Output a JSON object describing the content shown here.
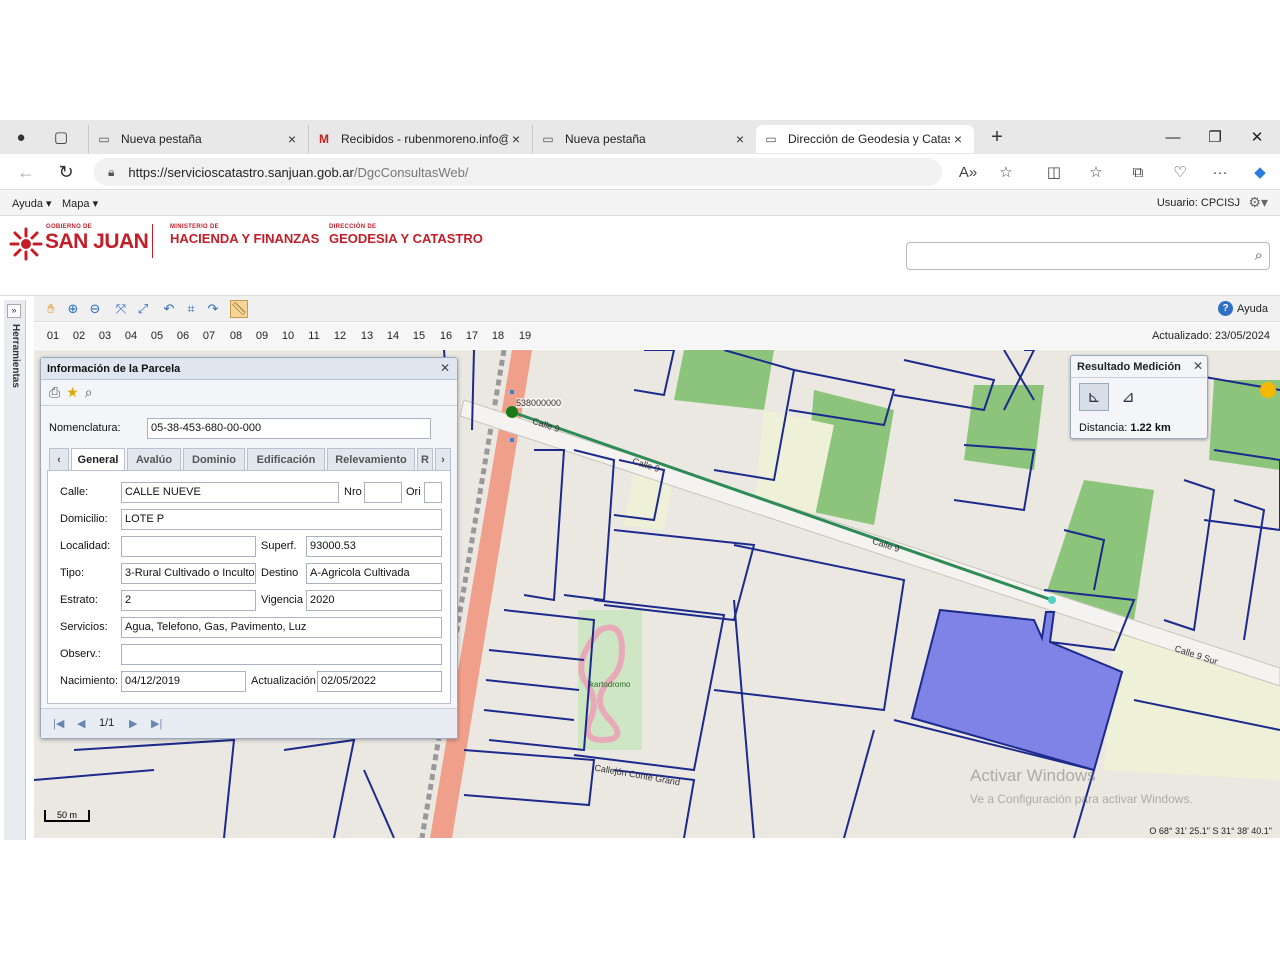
{
  "browser": {
    "tabs": [
      {
        "title": "Nueva pestaña",
        "icon": "page-icon"
      },
      {
        "title": "Recibidos - rubenmoreno.info@",
        "icon": "gmail-icon"
      },
      {
        "title": "Nueva pestaña",
        "icon": "page-icon"
      },
      {
        "title": "Dirección de Geodesia y Catastro",
        "icon": "page-icon",
        "active": true
      }
    ],
    "url_host": "https://servicioscatastro.sanjuan.gob.ar",
    "url_path": "/DgcConsultasWeb/"
  },
  "app": {
    "menu": [
      "Ayuda ▾",
      "Mapa ▾"
    ],
    "user": "Usuario: CPCISJ",
    "brand": {
      "gov_small": "GOBIERNO DE",
      "gov_big": "SAN JUAN",
      "min_small": "MINISTERIO DE",
      "min_big": "HACIENDA Y FINANZAS",
      "dir_small": "DIRECCIÓN DE",
      "dir_big": "GEODESIA Y CATASTRO"
    },
    "help_label": "Ayuda",
    "zones": [
      "01",
      "02",
      "03",
      "04",
      "05",
      "06",
      "07",
      "08",
      "09",
      "10",
      "11",
      "12",
      "13",
      "14",
      "15",
      "16",
      "17",
      "18",
      "19"
    ],
    "updated": "Actualizado: 23/05/2024",
    "side_label": "Herramientas"
  },
  "parcel": {
    "title": "Información de la Parcela",
    "nomenclatura_label": "Nomenclatura:",
    "nomenclatura": "05-38-453-680-00-000",
    "tabs": [
      "General",
      "Avalúo",
      "Dominio",
      "Edificación",
      "Relevamiento",
      "R"
    ],
    "fields": {
      "calle_label": "Calle:",
      "calle": "CALLE NUEVE",
      "nro_label": "Nro",
      "nro": "",
      "ori_label": "Ori",
      "ori": "",
      "domicilio_label": "Domicilio:",
      "domicilio": "LOTE P",
      "localidad_label": "Localidad:",
      "localidad": "",
      "superf_label": "Superf.",
      "superf": "93000.53",
      "tipo_label": "Tipo:",
      "tipo": "3-Rural Cultivado o Inculto",
      "destino_label": "Destino",
      "destino": "A-Agricola Cultivada",
      "estrato_label": "Estrato:",
      "estrato": "2",
      "vigencia_label": "Vigencia",
      "vigencia": "2020",
      "servicios_label": "Servicios:",
      "servicios": "Agua, Telefono, Gas, Pavimento, Luz",
      "observ_label": "Observ.:",
      "observ": "",
      "nacimiento_label": "Nacimiento:",
      "nacimiento": "04/12/2019",
      "actualizacion_label": "Actualización",
      "actualizacion": "02/05/2022"
    },
    "page": "1/1"
  },
  "measure": {
    "title": "Resultado Medición",
    "distance_label": "Distancia:",
    "distance": "1.22 km"
  },
  "map": {
    "street_labels": [
      "Calle 9",
      "Calle 9",
      "Calle 9",
      "Calle 9 Sur"
    ],
    "canal_label": "Callejón Conte Grand",
    "poi_label": "kartodromo",
    "measure_pt_label": "538000000",
    "scale": "50 m",
    "coords": "O 68° 31' 25.1\" S 31° 38' 40.1\""
  },
  "watermark": {
    "line1": "Activar Windows",
    "line2": "Ve a Configuración para activar Windows."
  },
  "colors": {
    "brand_red": "#c51d27",
    "parcel_blue": "#7f83e6",
    "field_green": "#8cc47b",
    "road_salmon": "#f0a08a",
    "measure_line": "#2e8b57"
  }
}
